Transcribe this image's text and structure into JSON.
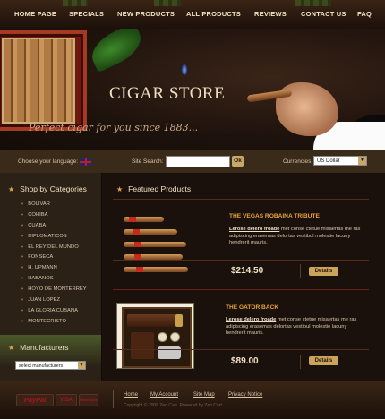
{
  "nav": {
    "items": [
      "HOME PAGE",
      "SPECIALS",
      "NEW PRODUCTS",
      "ALL PRODUCTS",
      "REVIEWS",
      "CONTACT US",
      "FAQ"
    ]
  },
  "banner": {
    "title": "CIGAR STORE",
    "tagline": "Perfect cigar for you since 1883..."
  },
  "search_bar": {
    "language_label": "Choose your language:",
    "search_label": "Site Search:",
    "search_value": "",
    "ok_label": "Ok",
    "currency_label": "Currencies:",
    "currency_value": "US Dollar"
  },
  "sidebar": {
    "categories_title": "Shop by Categories",
    "categories": [
      "BOLIVAR",
      "COHIBA",
      "CUABA",
      "DIPLOMATICOS",
      "EL REY DEL MUNDO",
      "FONSECA",
      "H. UPMANN",
      "HABANOS",
      "HOYO DE MONTERREY",
      "JUAN LOPEZ",
      "LA GLORIA CUBANA",
      "MONTECRISTO"
    ],
    "manufacturers_title": "Manufacturers",
    "manufacturers_select": "select manufacturers"
  },
  "main": {
    "featured_title": "Featured Products",
    "products": [
      {
        "name": "THE VEGAS ROBAINA TRIBUTE",
        "link_text": "Lerose delero froade",
        "desc": " met conse ctetue misaertas me ras adipiscing erasemas delortas vestibul molestie lacuny hendrerit mauris.",
        "price": "$214.50",
        "button": "Details"
      },
      {
        "name": "THE GATOR BACK",
        "link_text": "Lerose delero froade",
        "desc": " met conse ctetue misaertas me ras adipiscing erasemas delortas vestibul molestie lacuny hendrerit mauris.",
        "price": "$89.00",
        "button": "Details"
      }
    ]
  },
  "footer": {
    "payments": [
      "PayPal",
      "VISA",
      "MasterCard"
    ],
    "links": [
      "Home",
      "My Account",
      "Site Map",
      "Privacy Notice"
    ],
    "copyright": "Copyright © 2008 Zen Cart. Powered by Zen Cart"
  }
}
